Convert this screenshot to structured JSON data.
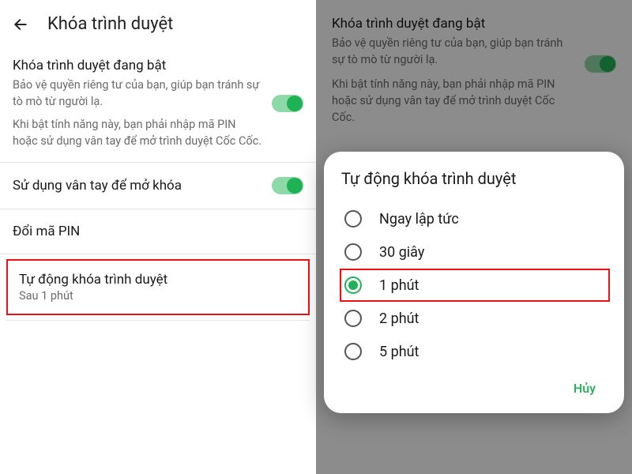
{
  "left": {
    "header_title": "Khóa trình duyệt",
    "lock_enabled_title": "Khóa trình duyệt đang bật",
    "lock_enabled_desc1": "Bảo vệ quyền riêng tư của bạn, giúp bạn tránh sự tò mò từ người lạ.",
    "lock_enabled_desc2": "Khi bật tính năng này, bạn phải nhập mã PIN hoặc sử dụng vân tay để mở trình duyệt Cốc Cốc.",
    "fingerprint_label": "Sử dụng vân tay để mở khóa",
    "change_pin_label": "Đổi mã PIN",
    "autolock_label": "Tự động khóa trình duyệt",
    "autolock_value": "Sau 1 phút"
  },
  "right_bg": {
    "title": "Khóa trình duyệt đang bật",
    "desc1": "Bảo vệ quyền riêng tư của bạn, giúp bạn tránh sự tò mò từ người lạ.",
    "desc2": "Khi bật tính năng này, bạn phải nhập mã PIN hoặc sử dụng vân tay để mở trình duyệt Cốc Cốc."
  },
  "dialog": {
    "title": "Tự động khóa trình duyệt",
    "options": [
      "Ngay lập tức",
      "30 giây",
      "1 phút",
      "2 phút",
      "5 phút"
    ],
    "selected_index": 2,
    "cancel": "Hủy"
  }
}
